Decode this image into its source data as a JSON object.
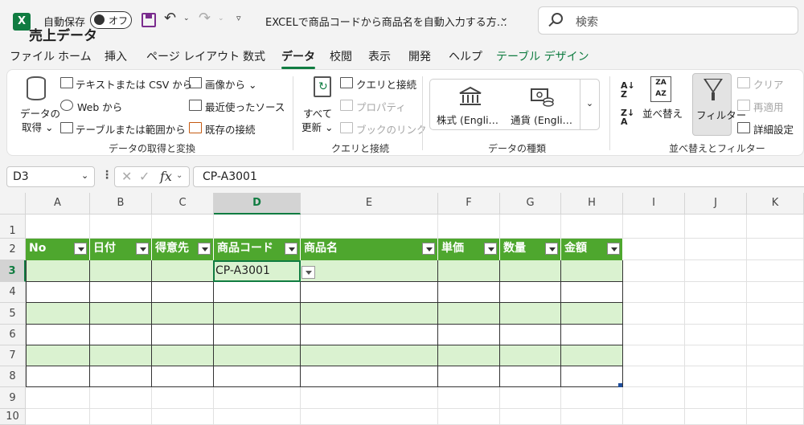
{
  "titlebar": {
    "app_icon": "excel-logo-icon",
    "app_letter": "X",
    "autosave_label": "自動保存",
    "autosave_state": "オフ",
    "document_title": "EXCELで商品コードから商品名を自動入力する方…",
    "search_placeholder": "検索"
  },
  "tabs": [
    "ファイル",
    "ホーム",
    "挿入",
    "ページ レイアウト",
    "数式",
    "データ",
    "校閲",
    "表示",
    "開発",
    "ヘルプ",
    "テーブル デザイン"
  ],
  "active_tab": "データ",
  "ribbon": {
    "get_data": {
      "big_button": "データの\n取得",
      "big_line1": "データの",
      "big_line2": "取得 ⌄",
      "items": [
        "テキストまたは CSV から",
        "Web から",
        "テーブルまたは範囲から",
        "画像から ⌄",
        "最近使ったソース",
        "既存の接続"
      ],
      "group_label": "データの取得と変換"
    },
    "queries": {
      "refresh_line1": "すべて",
      "refresh_line2": "更新 ⌄",
      "items": [
        "クエリと接続",
        "プロパティ",
        "ブックのリンク"
      ],
      "group_label": "クエリと接続"
    },
    "data_types": {
      "items": [
        "株式 (Engli…",
        "通貨 (Engli…"
      ],
      "group_label": "データの種類"
    },
    "sort_filter": {
      "sort_label": "並べ替え",
      "filter_label": "フィルター",
      "items": [
        "クリア",
        "再適用",
        "詳細設定"
      ],
      "group_label": "並べ替えとフィルター",
      "az": "A\nZ↓",
      "za": "Z\nA↓"
    }
  },
  "formula_bar": {
    "name_box": "D3",
    "fx": "fx",
    "value": "CP-A3001"
  },
  "grid": {
    "columns": [
      "A",
      "B",
      "C",
      "D",
      "E",
      "F",
      "G",
      "H",
      "I",
      "J",
      "K"
    ],
    "rows": [
      "1",
      "2",
      "3",
      "4",
      "5",
      "6",
      "7",
      "8",
      "9",
      "10"
    ],
    "selected_column": "D",
    "selected_row": "3",
    "title": "売上データ",
    "table_headers": [
      "No",
      "日付",
      "得意先",
      "商品コード",
      "商品名",
      "単価",
      "数量",
      "金額"
    ],
    "active_cell_value": "CP-A3001"
  },
  "colors": {
    "accent": "#107c41",
    "table_header": "#4ea72e",
    "band": "#daf2d0"
  }
}
